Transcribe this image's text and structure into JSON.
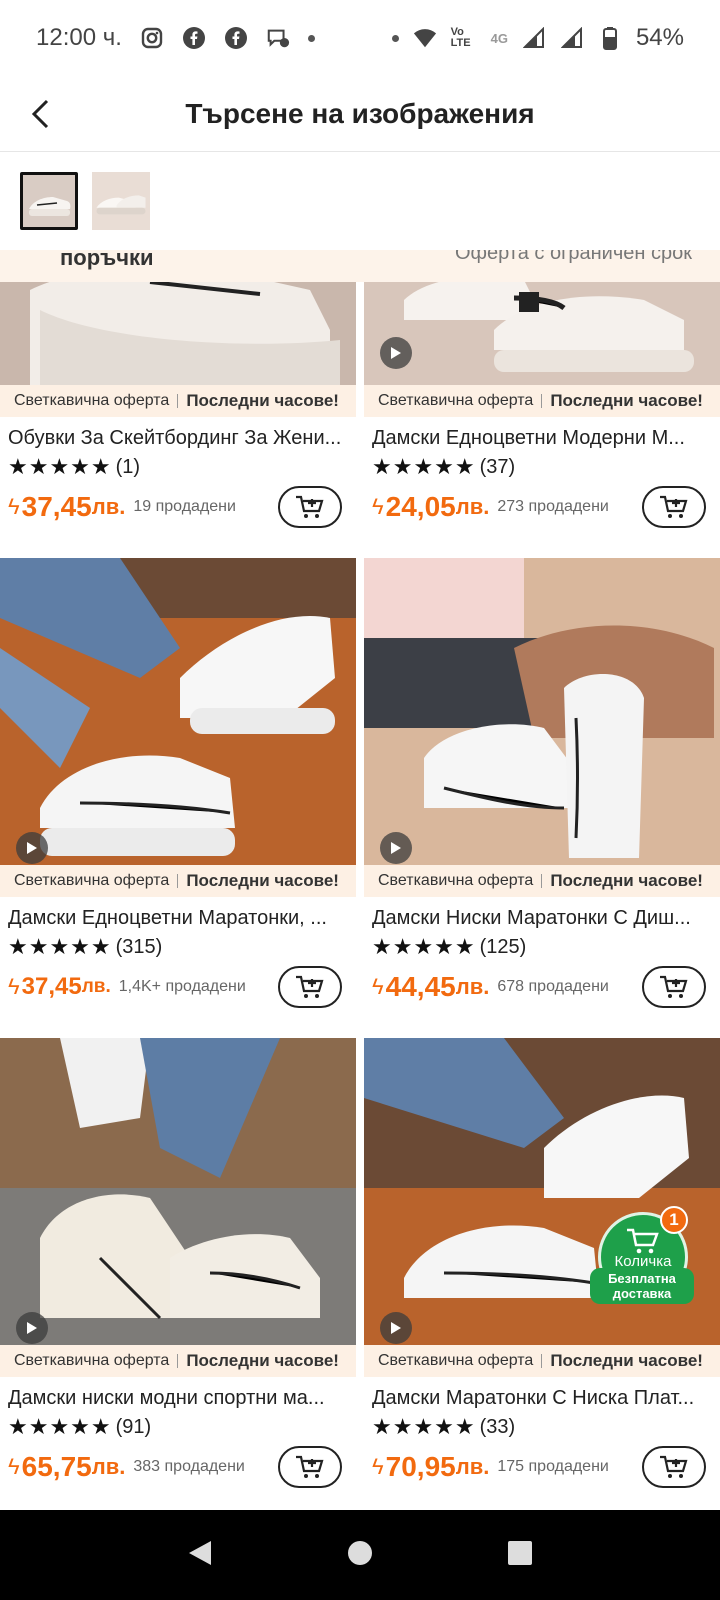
{
  "status": {
    "time": "12:00 ч.",
    "battery": "54%",
    "network": "4G",
    "volte": "Vo LTE"
  },
  "header": {
    "title": "Търсене на изображения"
  },
  "banner": {
    "left_text": "поръчки",
    "right_text": "Оферта с ограничен срок"
  },
  "flash_label": "Светкавична оферта",
  "flash_tag": "Последни часове!",
  "products": [
    {
      "title": "Обувки За Скейтбординг За Жени...",
      "rating": "(1)",
      "price": "37,45",
      "unit": "лв.",
      "sold": "19 продадени"
    },
    {
      "title": "Дамски Едноцветни Модерни М...",
      "rating": "(37)",
      "price": "24,05",
      "unit": "лв.",
      "sold": "273 продадени"
    },
    {
      "title": "Дамски Едноцветни Маратонки, ...",
      "rating": "(315)",
      "price": "37,45",
      "unit": "лв.",
      "sold": "1,4K+ продадени"
    },
    {
      "title": "Дамски Ниски Маратонки С Диш...",
      "rating": "(125)",
      "price": "44,45",
      "unit": "лв.",
      "sold": "678 продадени"
    },
    {
      "title": "Дамски ниски модни спортни ма...",
      "rating": "(91)",
      "price": "65,75",
      "unit": "лв.",
      "sold": "383 продадени"
    },
    {
      "title": "Дамски Маратонки С Ниска Плат...",
      "rating": "(33)",
      "price": "70,95",
      "unit": "лв.",
      "sold": "175 продадени"
    }
  ],
  "float_cart": {
    "label": "Количка",
    "badge": "1",
    "free_shipping": "Безплатна доставка"
  },
  "colors": {
    "accent": "#f26a0f",
    "flash_bg": "#fdf0e4",
    "cart_green": "#1ea04a"
  }
}
